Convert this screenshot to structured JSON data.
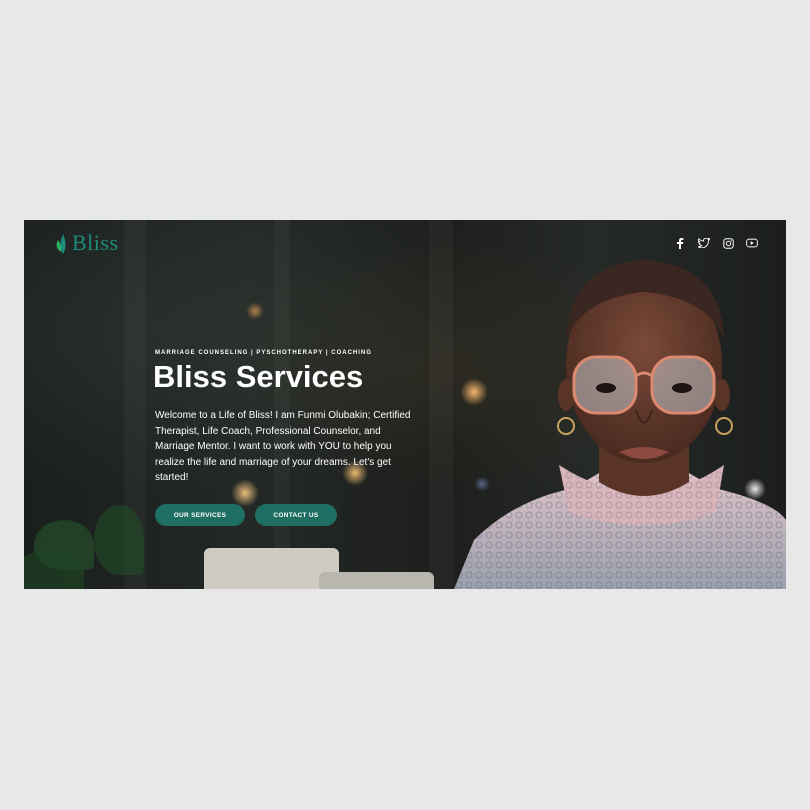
{
  "brand": {
    "logo_text": "Bliss"
  },
  "social": [
    {
      "icon": "facebook-icon"
    },
    {
      "icon": "twitter-icon"
    },
    {
      "icon": "instagram-icon"
    },
    {
      "icon": "youtube-icon"
    }
  ],
  "hero": {
    "eyebrow": "MARRIAGE COUNSELING | PYSCHOTHERAPY | COACHING",
    "title": "Bliss Services",
    "description": "Welcome to a Life of Bliss! I am Funmi Olubakin; Certified Therapist, Life Coach, Professional Counselor, and Marriage Mentor. I want to work with YOU to help you realize the life and marriage of your dreams. Let's get started!",
    "buttons": {
      "services": "OUR SERVICES",
      "contact": "CONTACT US"
    }
  },
  "colors": {
    "brand_teal": "#1c8c7a",
    "button_bg": "#1f6e63",
    "page_bg": "#e8e8e8",
    "hero_bg": "#14181a"
  }
}
